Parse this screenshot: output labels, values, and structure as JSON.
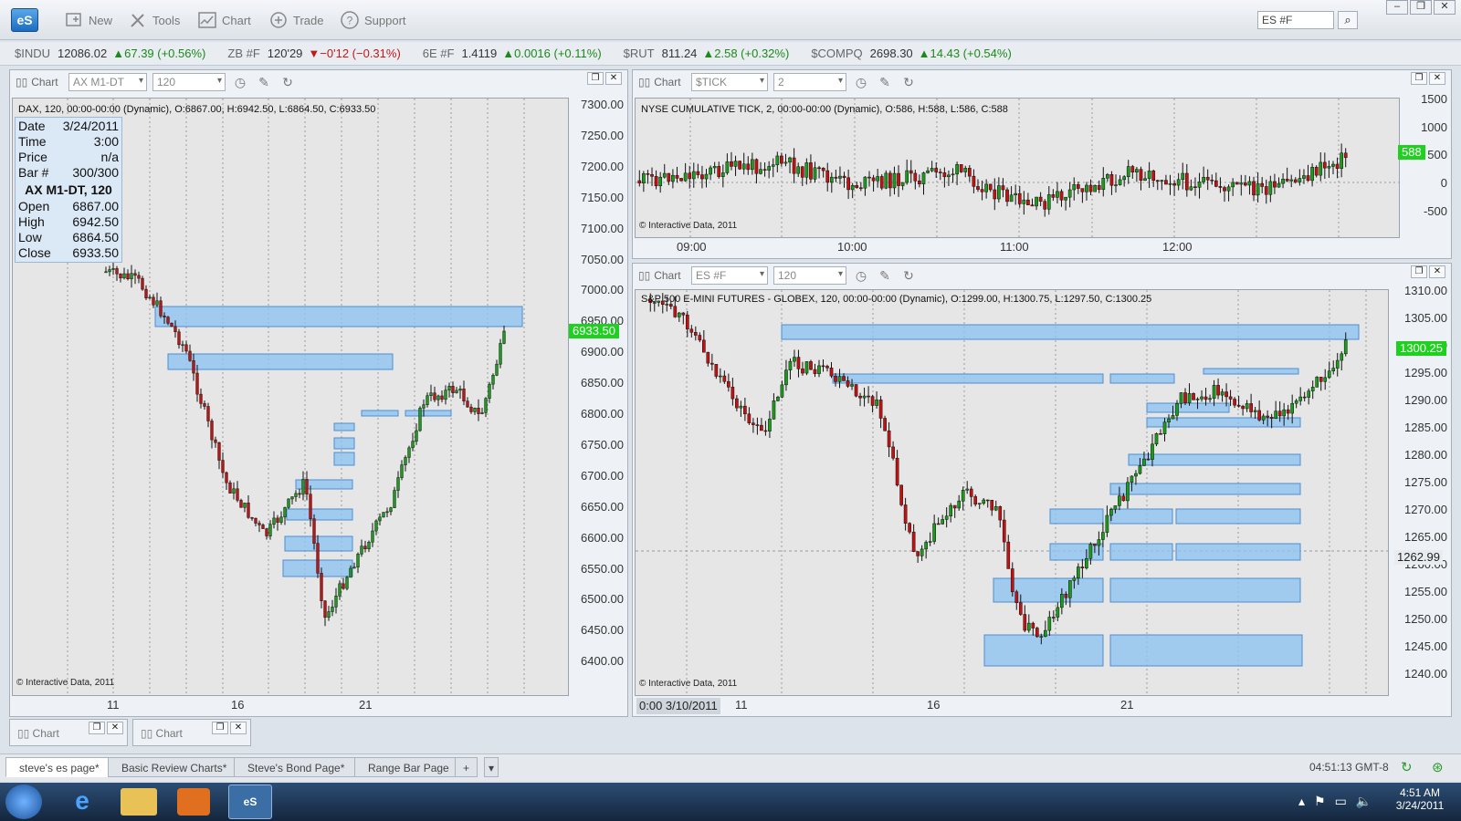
{
  "toolbar": {
    "logo": "eS",
    "buttons": [
      {
        "label": "New",
        "icon": "new-window-icon"
      },
      {
        "label": "Tools",
        "icon": "tools-icon"
      },
      {
        "label": "Chart",
        "icon": "chart-icon"
      },
      {
        "label": "Trade",
        "icon": "trade-icon"
      },
      {
        "label": "Support",
        "icon": "help-icon"
      }
    ],
    "symbol_select": "ES #F"
  },
  "ticker": [
    {
      "symbol": "$INDU",
      "price": "12086.02",
      "change": "▲67.39 (+0.56%)",
      "dir": "up"
    },
    {
      "symbol": "ZB #F",
      "price": "120'29",
      "change": "▼−0'12 (−0.31%)",
      "dir": "down"
    },
    {
      "symbol": "6E #F",
      "price": "1.4119",
      "change": "▲0.0016 (+0.11%)",
      "dir": "up"
    },
    {
      "symbol": "$RUT",
      "price": "811.24",
      "change": "▲2.58 (+0.32%)",
      "dir": "up"
    },
    {
      "symbol": "$COMPQ",
      "price": "2698.30",
      "change": "▲14.43 (+0.54%)",
      "dir": "up"
    }
  ],
  "panel_dax": {
    "title": "Chart",
    "symbol": "AX M1-DT",
    "interval": "120",
    "info": "DAX, 120, 00:00-00:00 (Dynamic), O:6867.00, H:6942.50, L:6864.50, C:6933.50",
    "copyright": "© Interactive Data, 2011",
    "last_price": "6933.50",
    "y_labels": [
      "7300.00",
      "7250.00",
      "7200.00",
      "7150.00",
      "7100.00",
      "7050.00",
      "7000.00",
      "6950.00",
      "6900.00",
      "6850.00",
      "6800.00",
      "6750.00",
      "6700.00",
      "6650.00",
      "6600.00",
      "6550.00",
      "6500.00",
      "6450.00",
      "6400.00"
    ],
    "x_labels": [
      "11",
      "16",
      "21"
    ],
    "datawin": {
      "rows_top": [
        [
          "Date",
          "3/24/2011"
        ],
        [
          "Time",
          "3:00"
        ],
        [
          "Price",
          "n/a"
        ],
        [
          "Bar #",
          "300/300"
        ]
      ],
      "header": "AX M1-DT, 120",
      "rows_ohlc": [
        [
          "Open",
          "6867.00"
        ],
        [
          "High",
          "6942.50"
        ],
        [
          "Low",
          "6864.50"
        ],
        [
          "Close",
          "6933.50"
        ]
      ]
    }
  },
  "panel_tick": {
    "title": "Chart",
    "symbol": "$TICK",
    "interval": "2",
    "info": "NYSE CUMULATIVE TICK, 2, 00:00-00:00 (Dynamic), O:586, H:588, L:586, C:588",
    "copyright": "© Interactive Data, 2011",
    "last_price": "588",
    "y_labels": [
      "1500",
      "1000",
      "500",
      "0",
      "-500"
    ],
    "x_labels": [
      "09:00",
      "10:00",
      "11:00",
      "12:00"
    ]
  },
  "panel_es": {
    "title": "Chart",
    "symbol": "ES #F",
    "interval": "120",
    "info": "S&P 500 E-MINI FUTURES - GLOBEX, 120, 00:00-00:00 (Dynamic), O:1299.00, H:1300.75, L:1297.50, C:1300.25",
    "copyright": "© Interactive Data, 2011",
    "last_price": "1300.25",
    "cursor_price": "1262.99",
    "y_labels": [
      "1310.00",
      "1305.00",
      "1300.00",
      "1295.00",
      "1290.00",
      "1285.00",
      "1280.00",
      "1275.00",
      "1270.00",
      "1265.00",
      "1260.00",
      "1255.00",
      "1250.00",
      "1245.00",
      "1240.00"
    ],
    "x_labels": [
      "11",
      "16",
      "21"
    ],
    "x_cursor": "0:00 3/10/2011"
  },
  "minimized": [
    "Chart",
    "Chart"
  ],
  "page_tabs": [
    "steve's es page*",
    "Basic Review Charts*",
    "Steve's Bond Page*",
    "Range Bar Page"
  ],
  "status": {
    "clock": "04:51:13 GMT-8"
  },
  "taskbar": {
    "time": "4:51 AM",
    "date": "3/24/2011"
  },
  "colors": {
    "up": "#1a9c1a",
    "down": "#c41010",
    "zone": "#8ec3f0",
    "last": "#1fd11f"
  }
}
